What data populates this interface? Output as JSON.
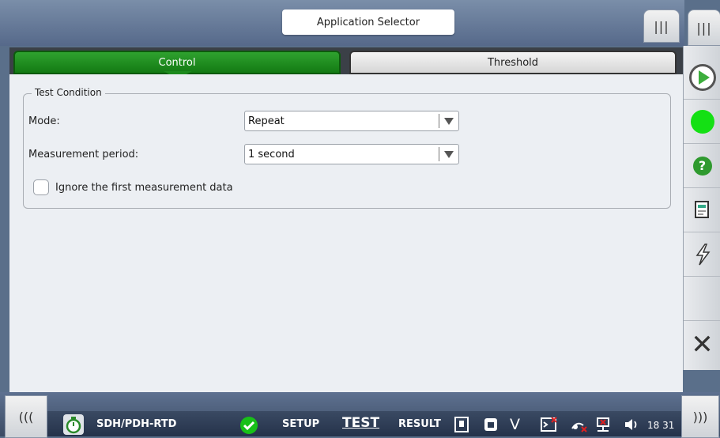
{
  "header": {
    "app_selector": "Application Selector",
    "grip_left": "|||",
    "grip_right": "|||"
  },
  "tabs": [
    {
      "label": "Control",
      "active": true
    },
    {
      "label": "Threshold",
      "active": false
    }
  ],
  "test_condition": {
    "legend": "Test Condition",
    "mode_label": "Mode:",
    "mode_value": "Repeat",
    "period_label": "Measurement period:",
    "period_value": "1 second",
    "ignore_label": "Ignore the first measurement data",
    "ignore_checked": false
  },
  "sidebar": {
    "help_glyph": "?",
    "close_glyph": "✕"
  },
  "bottom": {
    "left_grip": "(((",
    "right_grip": ")))",
    "app_name": "SDH/PDH-RTD",
    "setup": "SETUP",
    "test": "TEST",
    "result": "RESULT",
    "v_label": "V",
    "time": "18 31"
  },
  "colors": {
    "active_tab": "#1d8a1d",
    "status_green": "#14e014",
    "bar": "#3b4b64"
  }
}
